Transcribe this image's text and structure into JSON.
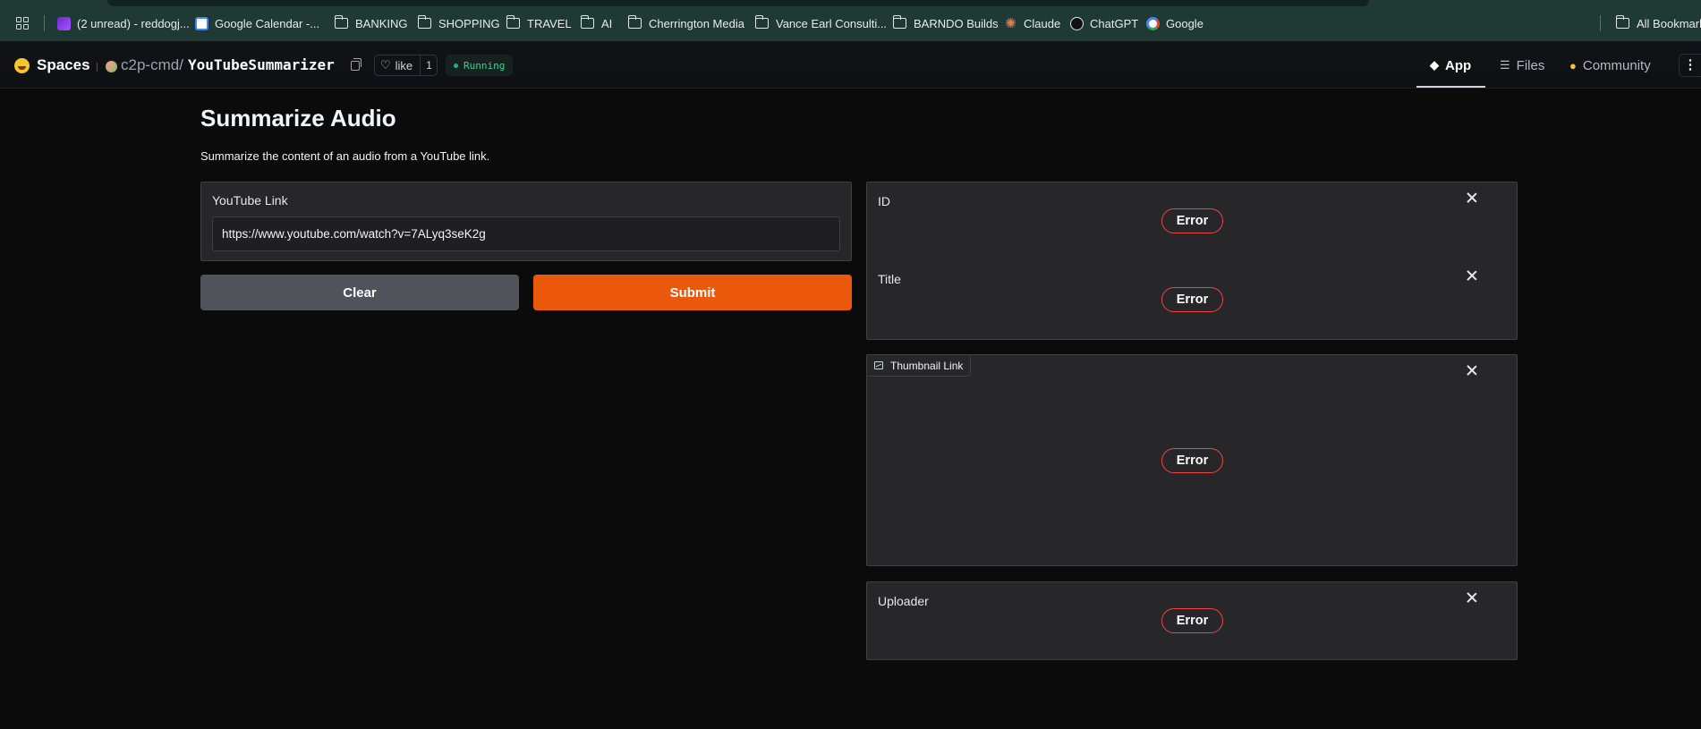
{
  "browser": {
    "bookmarks": [
      {
        "label": "(2 unread) - reddogj...",
        "icon": "mail-icon"
      },
      {
        "label": "Google Calendar -...",
        "icon": "calendar-icon"
      },
      {
        "label": "BANKING",
        "icon": "folder-icon"
      },
      {
        "label": "SHOPPING",
        "icon": "folder-icon"
      },
      {
        "label": "TRAVEL",
        "icon": "folder-icon"
      },
      {
        "label": "AI",
        "icon": "folder-icon"
      },
      {
        "label": "Cherrington Media",
        "icon": "folder-icon"
      },
      {
        "label": "Vance Earl Consulti...",
        "icon": "folder-icon"
      },
      {
        "label": "BARNDO Builds",
        "icon": "folder-icon"
      },
      {
        "label": "Claude",
        "icon": "claude-icon"
      },
      {
        "label": "ChatGPT",
        "icon": "chatgpt-icon"
      },
      {
        "label": "Google",
        "icon": "google-icon"
      }
    ],
    "all_bookmarks": "All Bookmarks"
  },
  "header": {
    "spaces": "Spaces",
    "owner": "c2p-cmd",
    "slash": "/",
    "repo": "YouTubeSummarizer",
    "like_label": "like",
    "like_count": "1",
    "status": "Running",
    "tabs": [
      {
        "label": "App",
        "icon": "cube-icon"
      },
      {
        "label": "Files",
        "icon": "files-icon"
      },
      {
        "label": "Community",
        "icon": "community-icon"
      }
    ],
    "more": "⋮"
  },
  "app": {
    "title": "Summarize Audio",
    "description": "Summarize the content of an audio from a YouTube link.",
    "input": {
      "label": "YouTube Link",
      "value": "https://www.youtube.com/watch?v=7ALyq3seK2g"
    },
    "buttons": {
      "clear": "Clear",
      "submit": "Submit"
    },
    "outputs": {
      "id_label": "ID",
      "title_label": "Title",
      "thumbnail_label": "Thumbnail Link",
      "uploader_label": "Uploader",
      "error": "Error"
    }
  },
  "colors": {
    "accent": "#ea580c",
    "error_border": "#ef4444",
    "running": "#34d399"
  }
}
